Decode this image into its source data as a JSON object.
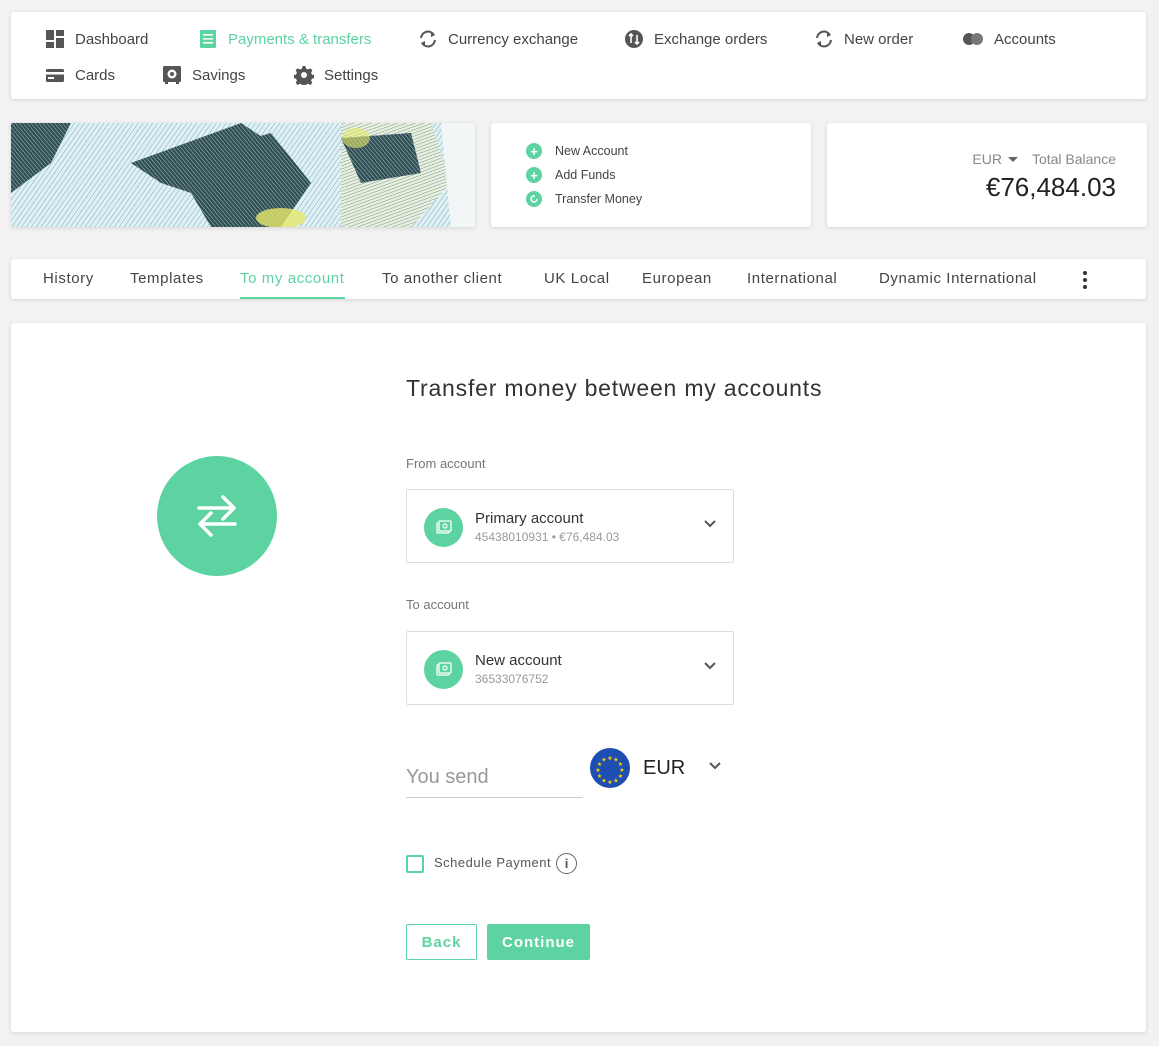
{
  "nav": {
    "items": [
      {
        "label": "Dashboard",
        "icon": "dashboard-icon"
      },
      {
        "label": "Payments & transfers",
        "icon": "payments-icon",
        "active": true
      },
      {
        "label": "Currency exchange",
        "icon": "exchange-icon"
      },
      {
        "label": "Exchange orders",
        "icon": "exchange-orders-icon"
      },
      {
        "label": "New order",
        "icon": "new-order-icon"
      },
      {
        "label": "Accounts",
        "icon": "accounts-icon"
      },
      {
        "label": "Cards",
        "icon": "cards-icon"
      },
      {
        "label": "Savings",
        "icon": "savings-icon"
      },
      {
        "label": "Settings",
        "icon": "gear-icon"
      }
    ]
  },
  "quick_actions": [
    {
      "label": "New Account",
      "icon": "plus-icon"
    },
    {
      "label": "Add Funds",
      "icon": "plus-icon"
    },
    {
      "label": "Transfer Money",
      "icon": "refresh-icon"
    }
  ],
  "balance": {
    "currency": "EUR",
    "label": "Total Balance",
    "amount": "€76,484.03"
  },
  "tabs": [
    {
      "label": "History"
    },
    {
      "label": "Templates"
    },
    {
      "label": "To my account",
      "active": true
    },
    {
      "label": "To another client"
    },
    {
      "label": "UK Local"
    },
    {
      "label": "European"
    },
    {
      "label": "International"
    },
    {
      "label": "Dynamic International"
    }
  ],
  "form": {
    "title": "Transfer money between my accounts",
    "from_label": "From account",
    "from_account": {
      "name": "Primary account",
      "details": "45438010931 • €76,484.03"
    },
    "to_label": "To account",
    "to_account": {
      "name": "New account",
      "details": "36533076752"
    },
    "send_placeholder": "You send",
    "currency": "EUR",
    "schedule_label": "Schedule Payment",
    "back_label": "Back",
    "continue_label": "Continue"
  },
  "colors": {
    "accent": "#5cd3a0",
    "flag_blue": "#1f4eb3",
    "flag_star": "#ffd600"
  }
}
